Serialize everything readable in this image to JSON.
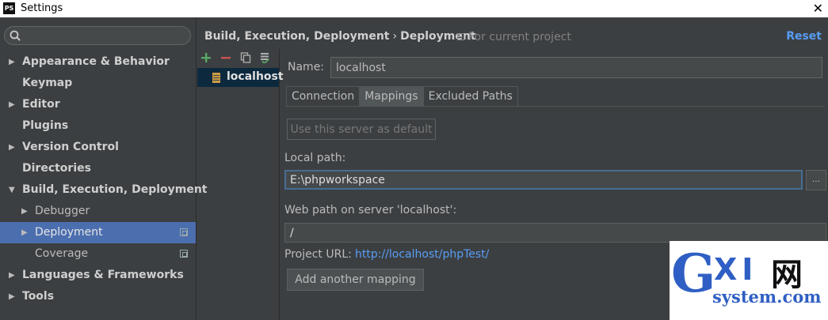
{
  "window": {
    "title": "Settings",
    "app_icon": "PS"
  },
  "search": {
    "placeholder": ""
  },
  "nav": {
    "items": [
      {
        "label": "Appearance & Behavior",
        "arrow": "▶"
      },
      {
        "label": "Keymap",
        "arrow": ""
      },
      {
        "label": "Editor",
        "arrow": "▶"
      },
      {
        "label": "Plugins",
        "arrow": ""
      },
      {
        "label": "Version Control",
        "arrow": "▶"
      },
      {
        "label": "Directories",
        "arrow": ""
      },
      {
        "label": "Build, Execution, Deployment",
        "arrow": "▼"
      },
      {
        "label": "Debugger",
        "arrow": "▶"
      },
      {
        "label": "Deployment",
        "arrow": "▶"
      },
      {
        "label": "Coverage",
        "arrow": ""
      },
      {
        "label": "Languages & Frameworks",
        "arrow": "▶"
      },
      {
        "label": "Tools",
        "arrow": "▶"
      }
    ],
    "selected": "Deployment"
  },
  "header": {
    "crumb_parent": "Build, Execution, Deployment",
    "crumb_separator": "›",
    "crumb_current": "Deployment",
    "scope": "For current project",
    "reset": "Reset"
  },
  "servers": {
    "items": [
      {
        "label": "localhost"
      }
    ]
  },
  "form": {
    "name_label": "Name:",
    "name_value": "localhost",
    "tabs": [
      "Connection",
      "Mappings",
      "Excluded Paths"
    ],
    "active_tab": "Mappings",
    "default_button": "Use this server as default",
    "local_path_label": "Local path:",
    "local_path_value": "E:\\phpworkspace",
    "browse_label": "...",
    "web_path_label": "Web path on server 'localhost':",
    "web_path_value": "/",
    "project_url_label": "Project URL:",
    "project_url_value": "http://localhost/phpTest/",
    "add_mapping_button": "Add another mapping"
  },
  "watermark": {
    "letter_g": "G",
    "letters_xi": "XI",
    "cn": "网",
    "domain": "system.com"
  },
  "colors": {
    "background": "#3c3f41",
    "selection": "#4b6eaf",
    "link": "#589df6",
    "server_selection": "#0d293e"
  }
}
